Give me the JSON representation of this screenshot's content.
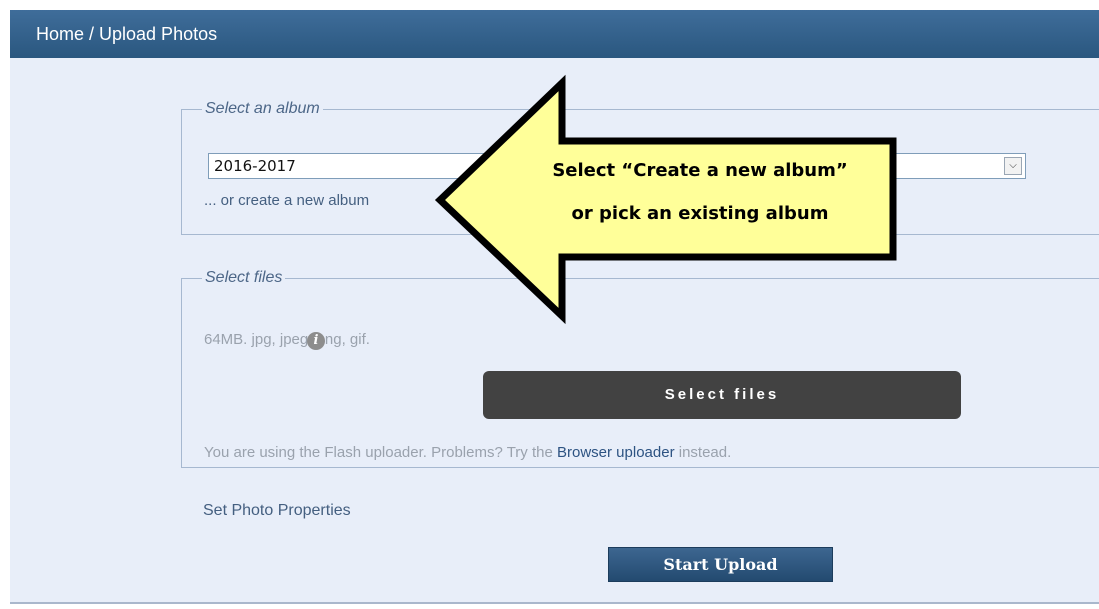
{
  "header": {
    "breadcrumb": "Home / Upload Photos"
  },
  "album_section": {
    "legend": "Select an album",
    "selected_album": "2016-2017",
    "dropdown_icon": "chevron-down-icon",
    "create_link": "... or create a new album"
  },
  "files_section": {
    "legend": "Select files",
    "limits_text": "64MB. jpg, jpeg, png, gif.",
    "info_icon": "info-icon",
    "select_files_label": "Select files",
    "flash_msg_prefix": "You are using the Flash uploader. Problems? Try the ",
    "flash_msg_link": "Browser uploader",
    "flash_msg_suffix": " instead."
  },
  "photo_properties_link": "Set Photo Properties",
  "start_upload_label": "Start Upload",
  "callout": {
    "line1": "Select “Create a new album”",
    "line2": "or pick an existing album",
    "fill": "#ffff99",
    "stroke": "#000000"
  },
  "colors": {
    "header_bg": "#2f5d8a",
    "content_bg": "#e8eef9",
    "accent_link": "#2d5382",
    "select_files_btn": "#424242"
  }
}
